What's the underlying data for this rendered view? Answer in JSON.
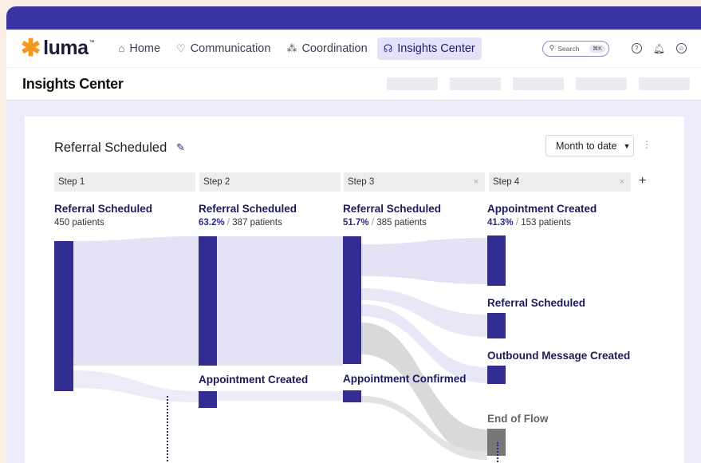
{
  "app": {
    "logo_text": "luma",
    "logo_tm": "™",
    "nav": [
      {
        "label": "Home",
        "icon": "home-icon",
        "glyph": "⌂"
      },
      {
        "label": "Communication",
        "icon": "heart-icon",
        "glyph": "♡"
      },
      {
        "label": "Coordination",
        "icon": "nodes-icon",
        "glyph": "⁂"
      },
      {
        "label": "Insights Center",
        "icon": "insights-icon",
        "glyph": "☊",
        "active": true
      }
    ],
    "search_placeholder": "Search",
    "search_shortcut": "⌘K"
  },
  "page": {
    "title": "Insights Center"
  },
  "card": {
    "title": "Referral Scheduled",
    "range": "Month to date",
    "steps": [
      {
        "header": "Step 1",
        "closable": false
      },
      {
        "header": "Step 2",
        "closable": false
      },
      {
        "header": "Step 3",
        "closable": true
      },
      {
        "header": "Step 4",
        "closable": true
      }
    ],
    "add_step": "+",
    "nodes": {
      "s1_main": {
        "label": "Referral Scheduled",
        "count": "450 patients"
      },
      "s2_main": {
        "label": "Referral Scheduled",
        "pct": "63.2%",
        "count": "387 patients"
      },
      "s2_alt": {
        "label": "Appointment Created"
      },
      "s3_main": {
        "label": "Referral Scheduled",
        "pct": "51.7%",
        "count": "385 patients"
      },
      "s3_alt": {
        "label": "Appointment Confirmed"
      },
      "s4_main": {
        "label": "Appointment Created",
        "pct": "41.3%",
        "count": "153 patients"
      },
      "s4_b": {
        "label": "Referral Scheduled"
      },
      "s4_c": {
        "label": "Outbound Message Created"
      },
      "s4_end": {
        "label": "End of Flow"
      }
    },
    "separator": "/",
    "colors": {
      "bar": "#332d93",
      "flow": "#e4e3f6",
      "drop": "#d9d9d9",
      "end_bar": "#777777"
    }
  }
}
